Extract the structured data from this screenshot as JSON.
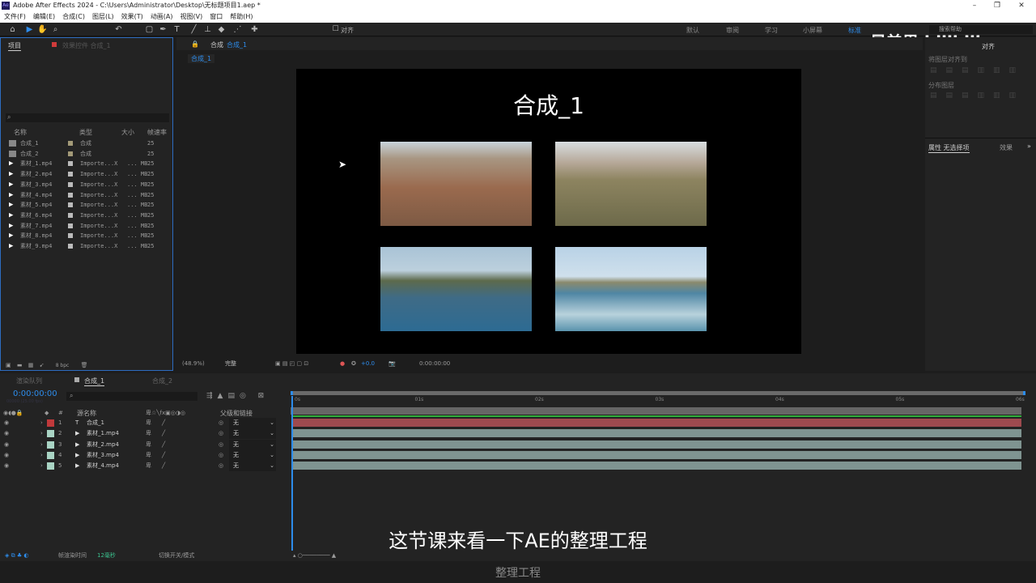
{
  "window": {
    "title": "Adobe After Effects 2024 - C:\\Users\\Administrator\\Desktop\\无标题项目1.aep *",
    "logo": "Ae",
    "minimize": "–",
    "restore": "❐",
    "close": "✕"
  },
  "menu": [
    "文件(F)",
    "编辑(E)",
    "合成(C)",
    "图层(L)",
    "效果(T)",
    "动画(A)",
    "视图(V)",
    "窗口",
    "帮助(H)"
  ],
  "toolbar": {
    "snap_label": "对齐",
    "workspaces": [
      "默认",
      "审阅",
      "学习",
      "小屏幕",
      "标准"
    ],
    "search_placeholder": "搜索帮助"
  },
  "watermark": "星美男 bilibili",
  "project_panel": {
    "tab": "项目",
    "effects_tab": "效果控件 合成_1",
    "columns": [
      "名称",
      "类型",
      "大小",
      "帧速率"
    ],
    "items": [
      {
        "name": "合成_1",
        "type": "合成",
        "size": "",
        "fps": "25",
        "kind": "comp"
      },
      {
        "name": "合成_2",
        "type": "合成",
        "size": "",
        "fps": "25",
        "kind": "comp"
      },
      {
        "name": "素材_1.mp4",
        "type": "Importe...X",
        "size": "... MB",
        "fps": "25",
        "kind": "video"
      },
      {
        "name": "素材_2.mp4",
        "type": "Importe...X",
        "size": "... MB",
        "fps": "25",
        "kind": "video"
      },
      {
        "name": "素材_3.mp4",
        "type": "Importe...X",
        "size": "... MB",
        "fps": "25",
        "kind": "video"
      },
      {
        "name": "素材_4.mp4",
        "type": "Importe...X",
        "size": "... MB",
        "fps": "25",
        "kind": "video"
      },
      {
        "name": "素材_5.mp4",
        "type": "Importe...X",
        "size": "... MB",
        "fps": "25",
        "kind": "video"
      },
      {
        "name": "素材_6.mp4",
        "type": "Importe...X",
        "size": "... MB",
        "fps": "25",
        "kind": "video"
      },
      {
        "name": "素材_7.mp4",
        "type": "Importe...X",
        "size": "... MB",
        "fps": "25",
        "kind": "video"
      },
      {
        "name": "素材_8.mp4",
        "type": "Importe...X",
        "size": "... MB",
        "fps": "25",
        "kind": "video"
      },
      {
        "name": "素材_9.mp4",
        "type": "Importe...X",
        "size": "... MB",
        "fps": "25",
        "kind": "video"
      }
    ],
    "bpc": "8 bpc"
  },
  "comp_panel": {
    "tab_prefix": "合成",
    "tab_name": "合成_1",
    "breadcrumb": "合成_1",
    "canvas_title": "合成_1",
    "zoom": "(48.9%)",
    "quality": "完整",
    "exposure": "+0.0",
    "timecode": "0:00:00:00"
  },
  "right_panel": {
    "align_tab": "对齐",
    "align_to": "将图层对齐到",
    "distribute": "分布图层",
    "properties_tab": "属性 无选择项",
    "effects_tab": "效果"
  },
  "timeline": {
    "tabs": [
      "渲染队列",
      "合成_1",
      "合成_2"
    ],
    "timecode": "0:00:00:00",
    "frame_info": "00000 (25.00 fps)",
    "columns": {
      "source": "源名称",
      "parent": "父级和链接"
    },
    "ticks": [
      "0s",
      "01s",
      "02s",
      "03s",
      "04s",
      "05s",
      "06s"
    ],
    "layers": [
      {
        "num": "1",
        "name": "合成_1",
        "type": "T",
        "color": "#c0393b",
        "parent": "无",
        "bar": "#9e4a4f"
      },
      {
        "num": "2",
        "name": "素材_1.mp4",
        "type": "video",
        "color": "#a9d4c4",
        "parent": "无",
        "bar": "#7f9491"
      },
      {
        "num": "3",
        "name": "素材_2.mp4",
        "type": "video",
        "color": "#a9d4c4",
        "parent": "无",
        "bar": "#7f9491"
      },
      {
        "num": "4",
        "name": "素材_3.mp4",
        "type": "video",
        "color": "#a9d4c4",
        "parent": "无",
        "bar": "#7f9491"
      },
      {
        "num": "5",
        "name": "素材_4.mp4",
        "type": "video",
        "color": "#a9d4c4",
        "parent": "无",
        "bar": "#7f9491"
      }
    ],
    "footer": {
      "render_label": "帧渲染时间",
      "render_value": "12毫秒",
      "toggle": "切换开关/模式"
    }
  },
  "subtitle": "这节课来看一下AE的整理工程",
  "caption": "整理工程"
}
